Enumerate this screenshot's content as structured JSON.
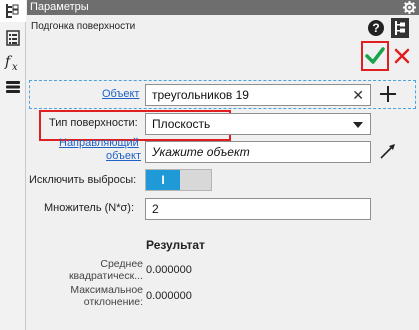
{
  "window": {
    "title": "Параметры"
  },
  "panel": {
    "subtitle": "Подгонка поверхности"
  },
  "object": {
    "label": "Объект",
    "value": "треугольников 19"
  },
  "surface_type": {
    "label": "Тип поверхности:",
    "value": "Плоскость"
  },
  "direction_object": {
    "label_line1": "Направляющий",
    "label_line2": "объект",
    "placeholder": "Укажите объект"
  },
  "exclude_outliers": {
    "label": "Исключить выбросы:",
    "state": "on",
    "on_text": "I"
  },
  "multiplier": {
    "label": "Множитель (N*σ):",
    "value": "2"
  },
  "result": {
    "title": "Результат",
    "rms_label_line1": "Среднее",
    "rms_label_line2": "квадратическ...",
    "rms_value": "0.000000",
    "max_label_line1": "Максимальное",
    "max_label_line2": "отклонение:",
    "max_value": "0.000000"
  },
  "icons": {
    "help": "?",
    "colors": {
      "ok": "#1aa34a",
      "cancel": "#e02020",
      "highlight": "#e02020",
      "toggle_on": "#1f9ad6",
      "link": "#1e62c6"
    }
  }
}
